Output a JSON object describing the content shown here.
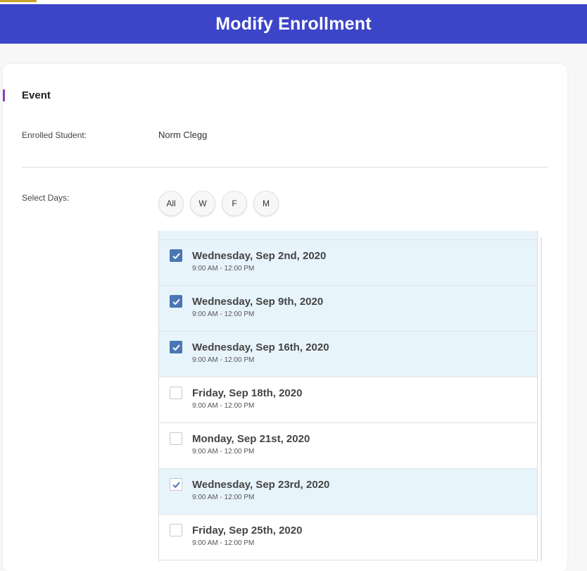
{
  "header": {
    "title": "Modify Enrollment"
  },
  "event": {
    "section_title": "Event",
    "enrolled_label": "Enrolled Student:",
    "enrolled_value": "Norm Clegg",
    "select_days_label": "Select Days:"
  },
  "day_filters": [
    "All",
    "W",
    "F",
    "M"
  ],
  "sessions": [
    {
      "date": "Wednesday, Sep 2nd, 2020",
      "time": "9:00 AM - 12:00 PM",
      "checked": true
    },
    {
      "date": "Wednesday, Sep 9th, 2020",
      "time": "9:00 AM - 12:00 PM",
      "checked": true
    },
    {
      "date": "Wednesday, Sep 16th, 2020",
      "time": "9:00 AM - 12:00 PM",
      "checked": true
    },
    {
      "date": "Friday, Sep 18th, 2020",
      "time": "9:00 AM - 12:00 PM",
      "checked": false
    },
    {
      "date": "Monday, Sep 21st, 2020",
      "time": "9:00 AM - 12:00 PM",
      "checked": false
    },
    {
      "date": "Wednesday, Sep 23rd, 2020",
      "time": "9:00 AM - 12:00 PM",
      "checked": true,
      "focused": true
    },
    {
      "date": "Friday, Sep 25th, 2020",
      "time": "9:00 AM - 12:00 PM",
      "checked": false
    }
  ],
  "colors": {
    "header_bg": "#3c45c8",
    "accent_bar": "#8a3fbf",
    "checked_row_bg": "#e8f4fc",
    "checkbox_on": "#4c76b3"
  },
  "icons": {
    "checkbox": "check-icon"
  }
}
